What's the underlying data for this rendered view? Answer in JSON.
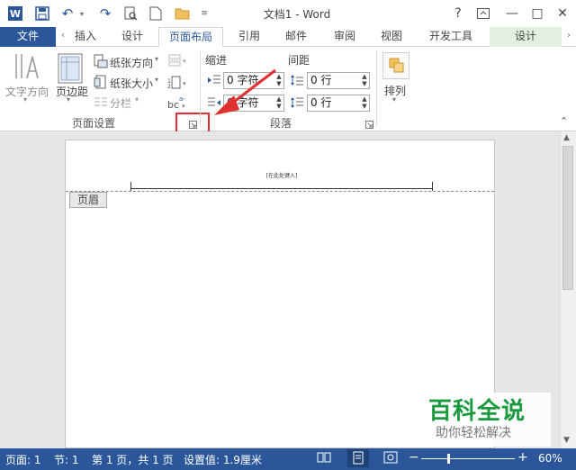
{
  "window": {
    "title": "文档1 - Word",
    "help": "?",
    "minimize": "—",
    "restore": "□",
    "close": "✕"
  },
  "tabs": {
    "file": "文件",
    "insert": "插入",
    "design": "设计",
    "layout": "页面布局",
    "references": "引用",
    "mailings": "邮件",
    "review": "审阅",
    "view": "视图",
    "developer": "开发工具",
    "header_design": "设计"
  },
  "ribbon": {
    "text_direction": "文字方向",
    "margins": "页边距",
    "orientation": "纸张方向",
    "size": "纸张大小",
    "columns": "分栏",
    "page_setup_group": "页面设置",
    "indent_label": "缩进",
    "spacing_label": "间距",
    "indent_left": "0 字符",
    "indent_right": "0 字符",
    "spacing_before": "0 行",
    "spacing_after": "0 行",
    "paragraph_group": "段落",
    "arrange": "排列"
  },
  "document": {
    "header_placeholder": "[在此处键入]",
    "header_tag": "页眉"
  },
  "statusbar": {
    "page": "页面: 1",
    "section": "节: 1",
    "page_of": "第 1 页，共 1 页",
    "position": "设置值: 1.9厘米",
    "zoom": "60%",
    "zoom_minus": "−",
    "zoom_plus": "+"
  },
  "watermark": {
    "title": "百科全说",
    "subtitle": "助你轻松解决"
  },
  "colors": {
    "word_blue": "#2b579a",
    "highlight_red": "#e03030",
    "watermark_green": "#1a9a3e"
  }
}
